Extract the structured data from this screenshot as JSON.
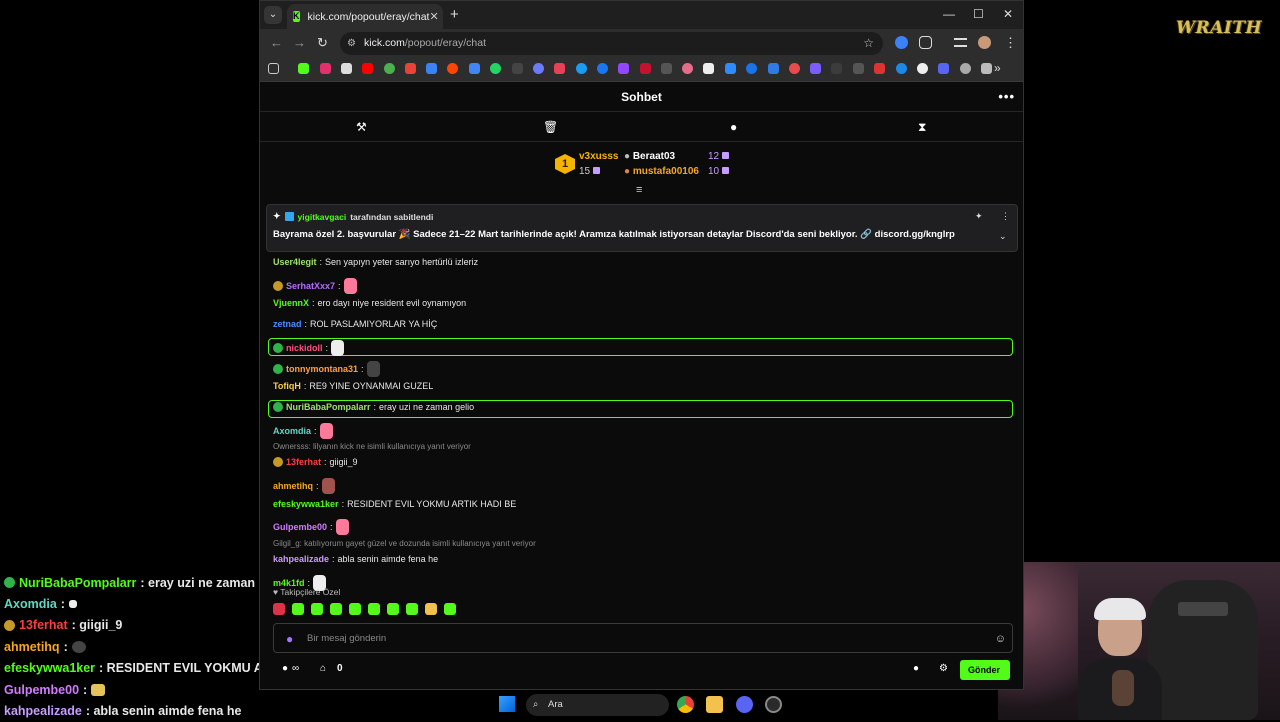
{
  "browser": {
    "tab_title": "kick.com/popout/eray/chat",
    "tab_favicon": "K",
    "new_tab": "+",
    "url_host": "kick.com",
    "url_path": "/popout/eray/chat",
    "window_controls": {
      "minimize": "—",
      "maximize": "☐",
      "close": "✕"
    }
  },
  "chat": {
    "header_title": "Sohbet",
    "header_more": "•••",
    "mod_tools": [
      "pin-icon",
      "trash-icon",
      "chat-bubble-icon",
      "hourglass-icon"
    ],
    "top_gifters": {
      "rank1_badge": "1",
      "first": {
        "name": "v3xusss",
        "count": "15"
      },
      "second": {
        "name": "Beraat03",
        "count": "12"
      },
      "third": {
        "name": "mustafa00106",
        "count": "10"
      }
    },
    "pinned": {
      "pinned_by_user": "yigitkavgaci",
      "pinned_by_text": "tarafından sabitlendi",
      "message": "Bayrama özel 2. başvurular 🎉 Sadece 21–22 Mart tarihlerinde açık! Aramıza katılmak istiyorsan detaylar Discord'da seni bekliyor. 🔗 discord.gg/knglrp"
    },
    "messages": [
      {
        "user": "User4legit",
        "text": "Sen yapıyn yeter sarıyo hertürlü izleriz",
        "color": "#9ce36b"
      },
      {
        "user": "SerhatXxx7",
        "text": "",
        "color": "#b46bff",
        "emote": true
      },
      {
        "user": "VjuennX",
        "text": "ero dayı niye resident evil oynamıyon",
        "color": "#53fc18"
      },
      {
        "user": "zetnad",
        "text": "ROL PASLAMIYORLAR YA HİÇ",
        "color": "#4b8cff"
      },
      {
        "user": "nickidoll",
        "text": "",
        "color": "#ff4f7a",
        "emote": true,
        "highlight": true
      },
      {
        "user": "tonnymontana31",
        "text": "",
        "color": "#ff9f43",
        "emote": true
      },
      {
        "user": "TofiqH",
        "text": "RE9 YINE OYNANMAI GUZEL",
        "color": "#ffcc4d"
      },
      {
        "user": "NuriBabaPompalarr",
        "text": "eray uzi ne zaman gelio",
        "color": "#9ce36b",
        "highlight": true
      },
      {
        "user": "Axomdia",
        "text": "",
        "color": "#5ed8c3",
        "emote": true
      },
      {
        "user": "13ferhat",
        "text": "giigii_9",
        "color": "#ff3d3d",
        "reply": "Ownersss: lilyanın kick ne isimli kullanıcıya yanıt veriyor"
      },
      {
        "user": "ahmetihq",
        "text": "",
        "color": "#f5a623",
        "emote": true
      },
      {
        "user": "efeskywwa1ker",
        "text": "RESIDENT EVIL YOKMU ARTIK HADI BE",
        "color": "#53fc18"
      },
      {
        "user": "Gulpembe00",
        "text": "",
        "color": "#d27bff",
        "emote": true
      },
      {
        "user": "kahpealizade",
        "text": "abla senin aimde fena he",
        "color": "#c79dff",
        "reply": "Gilgil_g: katılıyorum gayet güzel ve dozunda isimli kullanıcıya yanıt veriyor"
      },
      {
        "user": "m4k1fd",
        "text": "",
        "color": "#53fc18",
        "emote": true
      }
    ],
    "emote_section": "Takipçilere Özel",
    "input_placeholder": "Bir mesaj gönderin",
    "bottom": {
      "infinity": "∞",
      "gift_count": "0",
      "send_label": "Gönder"
    }
  },
  "overlay_chat": [
    {
      "user": "NuriBabaPompalarr",
      "text": ": eray uzi ne zaman gelio",
      "color": "#53fc18"
    },
    {
      "user": "Axomdia",
      "text": ":",
      "color": "#5ed8c3"
    },
    {
      "user": "13ferhat",
      "text": ": giigii_9",
      "color": "#ff3d3d"
    },
    {
      "user": "ahmetihq",
      "text": ":",
      "color": "#f5a623"
    },
    {
      "user": "efeskywwa1ker",
      "text": ": RESIDENT EVIL YOKMU ARTIK HA",
      "color": "#53fc18"
    },
    {
      "user": "Gulpembe00",
      "text": ":",
      "color": "#d27bff"
    },
    {
      "user": "kahpealizade",
      "text": ": abla senin aimde fena he",
      "color": "#c79dff"
    }
  ],
  "stream_logo": "WRAITH",
  "taskbar": {
    "search_placeholder": "Ara"
  }
}
